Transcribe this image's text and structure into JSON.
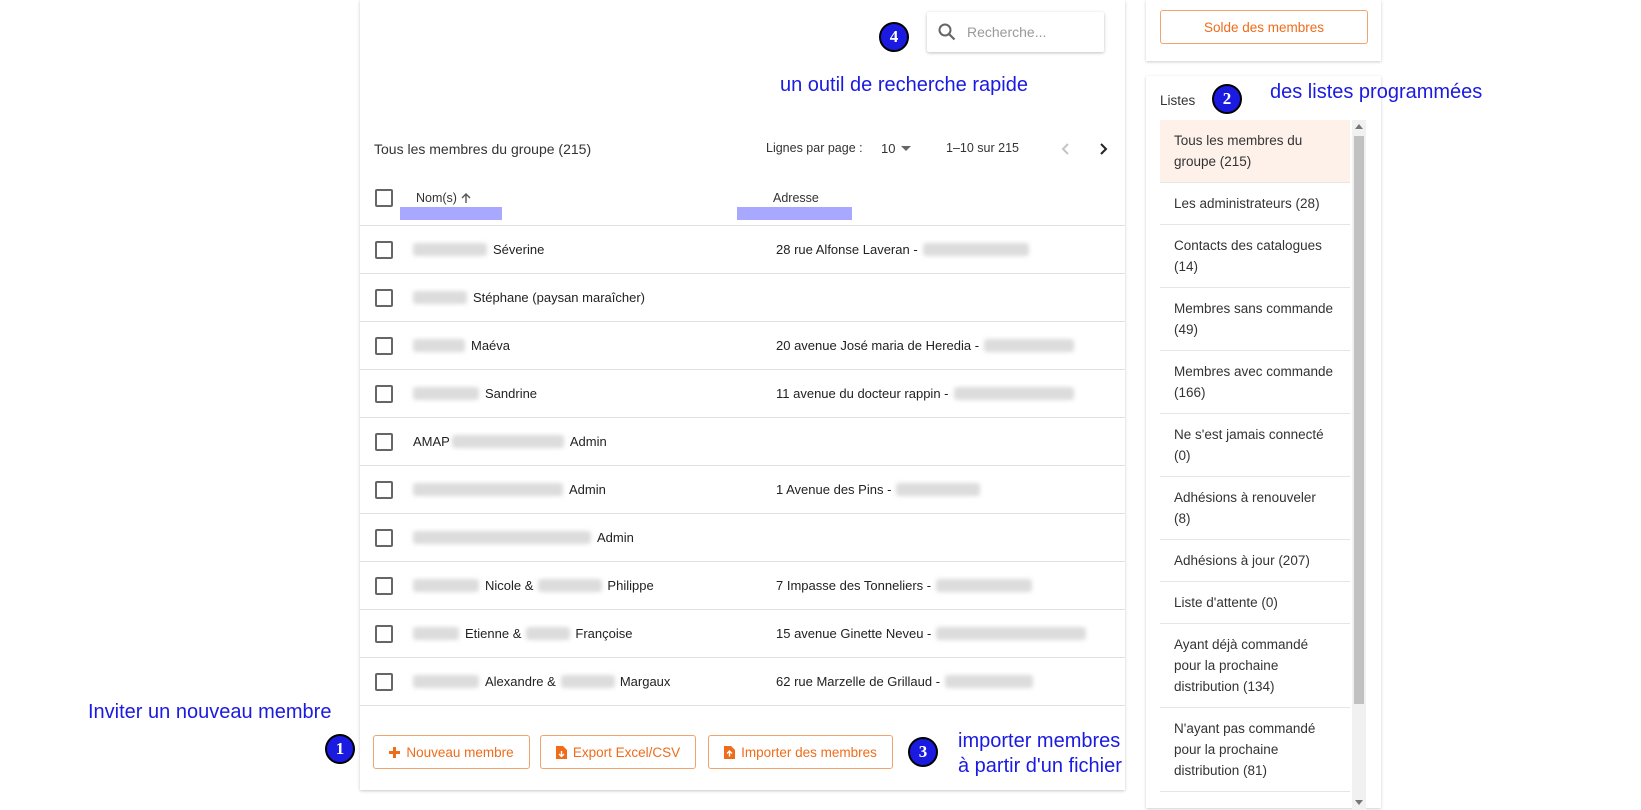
{
  "search": {
    "placeholder": "Recherche..."
  },
  "table": {
    "title": "Tous les membres du groupe (215)",
    "rows_per_page_label": "Lignes par page :",
    "rows_per_page_value": "10",
    "range": "1–10 sur 215",
    "columns": {
      "name": "Nom(s)",
      "address": "Adresse"
    },
    "rows": [
      {
        "name": "Séverine",
        "address": "28 rue Alfonse Laveran -"
      },
      {
        "name": "Stéphane (paysan maraîcher)",
        "address": ""
      },
      {
        "name": "Maéva",
        "address": "20 avenue José maria de Heredia -"
      },
      {
        "name": "Sandrine",
        "address": "11 avenue du docteur rappin -"
      },
      {
        "name_prefix": "AMAP",
        "name": "Admin",
        "address": ""
      },
      {
        "name": "Admin",
        "address": "1 Avenue des Pins -"
      },
      {
        "name": "Admin",
        "address": ""
      },
      {
        "name": "Nicole &",
        "name2": "Philippe",
        "address": "7 Impasse des Tonneliers -"
      },
      {
        "name": "Etienne &",
        "name2": "Françoise",
        "address": "15 avenue Ginette Neveu -"
      },
      {
        "name": "Alexandre &",
        "name2": "Margaux",
        "address": "62 rue Marzelle de Grillaud -"
      }
    ]
  },
  "actions": {
    "new_member": "Nouveau membre",
    "export": "Export Excel/CSV",
    "import": "Importer des membres"
  },
  "side": {
    "solde_button": "Solde des membres",
    "lists_title": "Listes",
    "lists": [
      "Tous les membres du groupe (215)",
      "Les administrateurs (28)",
      "Contacts des catalogues (14)",
      "Membres sans commande (49)",
      "Membres avec commande (166)",
      "Ne s'est jamais connecté (0)",
      "Adhésions à renouveler (8)",
      "Adhésions à jour (207)",
      "Liste d'attente (0)",
      "Ayant déjà commandé pour la prochaine distribution (134)",
      "N'ayant pas commandé pour la prochaine distribution (81)"
    ]
  },
  "annotations": {
    "badge1": "1",
    "badge2": "2",
    "badge3": "3",
    "badge4": "4",
    "text1": "Inviter un nouveau membre",
    "text2": "des listes programmées",
    "text3_line1": "importer membres",
    "text3_line2": "à partir d'un fichier",
    "text4": "un outil de recherche rapide"
  },
  "colors": {
    "accent": "#ef6c1a",
    "annotation": "#1a1ae0",
    "active_item": "#fdf1ea"
  }
}
